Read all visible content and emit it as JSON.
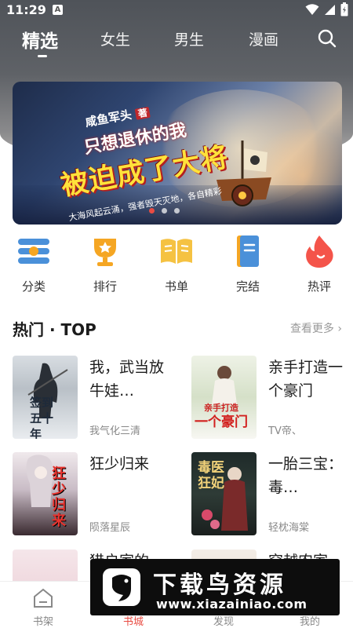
{
  "status_bar": {
    "time": "11:29",
    "notification_letter": "A"
  },
  "tabs": [
    {
      "label": "精选",
      "active": true
    },
    {
      "label": "女生",
      "active": false
    },
    {
      "label": "男生",
      "active": false
    },
    {
      "label": "漫画",
      "active": false
    }
  ],
  "banner": {
    "prefix": "咸鱼军头",
    "prefix_tag": "著",
    "line1": "只想退休的我",
    "line2": "被迫成了大将",
    "subtitle": "大海风起云涌，强者毁天灭地，各自精彩",
    "slide_count": 3,
    "active_slide": 1
  },
  "categories": [
    {
      "label": "分类",
      "icon": "list-icon"
    },
    {
      "label": "排行",
      "icon": "trophy-icon"
    },
    {
      "label": "书单",
      "icon": "book-open-icon"
    },
    {
      "label": "完结",
      "icon": "notebook-icon"
    },
    {
      "label": "热评",
      "icon": "flame-icon"
    }
  ],
  "hot_section": {
    "title": "热门 · TOP",
    "more": "查看更多"
  },
  "books": [
    {
      "title": "我，武当放牛娃…",
      "author": "我气化三清",
      "cover_text": "签到五十年"
    },
    {
      "title": "亲手打造一个豪门",
      "author": "TV帝、",
      "cover_text": "一个豪门",
      "cover_top": "亲手打造"
    },
    {
      "title": "狂少归来",
      "author": "陨落星辰",
      "cover_text": "狂少归来"
    },
    {
      "title": "一胎三宝：毒…",
      "author": "轻枕海棠",
      "cover_text": "毒医狂妃"
    },
    {
      "title": "猎户家的",
      "author": ""
    },
    {
      "title": "穿越农家",
      "author": ""
    }
  ],
  "bottom_nav": [
    {
      "label": "书架",
      "icon": "home-icon"
    },
    {
      "label": "书城",
      "icon": "store-icon"
    },
    {
      "label": "发现",
      "icon": "compass-icon"
    },
    {
      "label": "我的",
      "icon": "user-icon"
    }
  ],
  "watermark": {
    "title": "下载鸟资源",
    "url": "www.xiazainiao.com"
  },
  "colors": {
    "accent": "#e94c43",
    "header": "#5a5d62",
    "category_blue": "#4a90d9",
    "category_orange": "#f5a623",
    "category_red": "#f4544a"
  }
}
